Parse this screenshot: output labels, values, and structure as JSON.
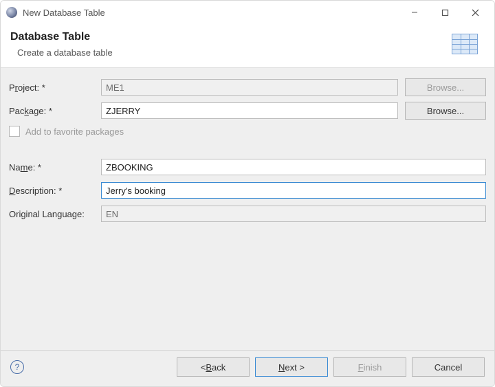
{
  "window": {
    "title": "New Database Table"
  },
  "header": {
    "title": "Database Table",
    "subtitle": "Create a database table"
  },
  "form": {
    "project": {
      "label_pre": "P",
      "label_ul": "r",
      "label_post": "oject: *",
      "value": "ME1",
      "browse": "Browse..."
    },
    "package": {
      "label_pre": "Pac",
      "label_ul": "k",
      "label_post": "age: *",
      "value": "ZJERRY",
      "browse": "Browse..."
    },
    "favorites": {
      "label_pre": "Add to fa",
      "label_ul": "v",
      "label_post": "orite packages"
    },
    "name": {
      "label_pre": "Na",
      "label_ul": "m",
      "label_post": "e: *",
      "value": "ZBOOKING"
    },
    "description": {
      "label_pre": "",
      "label_ul": "D",
      "label_post": "escription: *",
      "value": "Jerry's booking"
    },
    "original_lang": {
      "label": "Original Language:",
      "value": "EN"
    }
  },
  "footer": {
    "back_pre": "< ",
    "back_ul": "B",
    "back_post": "ack",
    "next_pre": "",
    "next_ul": "N",
    "next_post": "ext >",
    "finish_pre": "",
    "finish_ul": "F",
    "finish_post": "inish",
    "cancel": "Cancel"
  }
}
